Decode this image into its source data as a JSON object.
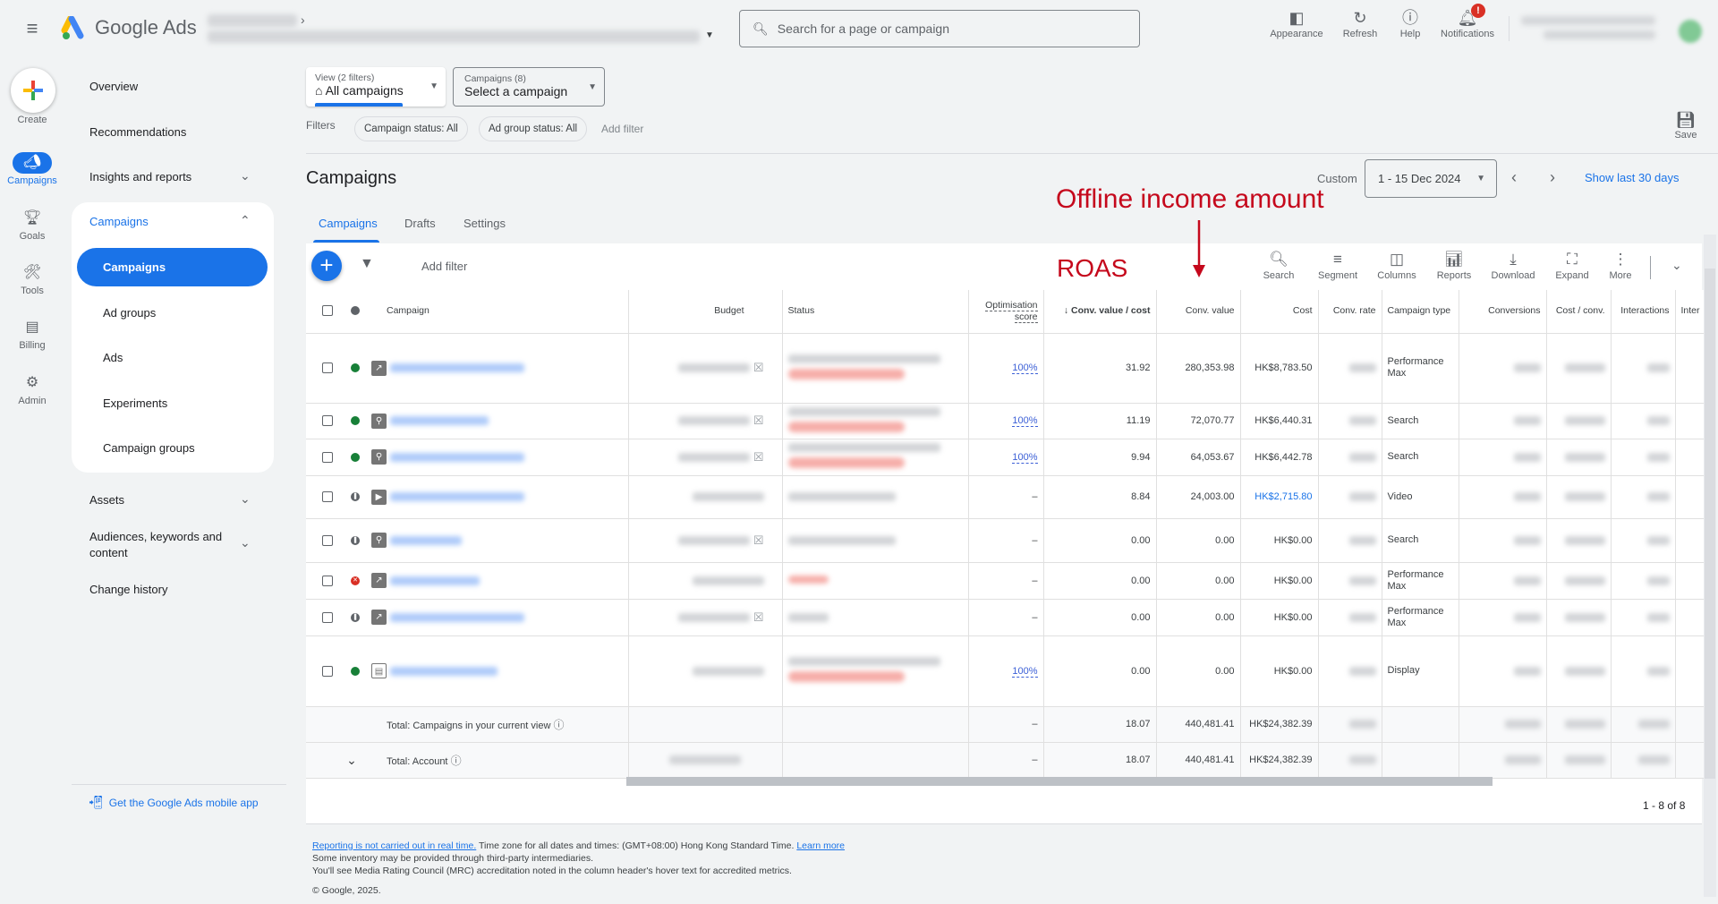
{
  "topbar": {
    "brand": "Google Ads",
    "search_placeholder": "Search for a page or campaign",
    "tools": [
      {
        "label": "Appearance",
        "icon": "appearance-icon"
      },
      {
        "label": "Refresh",
        "icon": "refresh-icon"
      },
      {
        "label": "Help",
        "icon": "help-icon"
      },
      {
        "label": "Notifications",
        "icon": "bell-icon",
        "badge": "!"
      }
    ]
  },
  "rail": {
    "items": [
      {
        "label": "Create",
        "icon": "plus-icon"
      },
      {
        "label": "Campaigns",
        "icon": "megaphone-icon",
        "active": true
      },
      {
        "label": "Goals",
        "icon": "trophy-icon"
      },
      {
        "label": "Tools",
        "icon": "tools-icon"
      },
      {
        "label": "Billing",
        "icon": "card-icon"
      },
      {
        "label": "Admin",
        "icon": "gear-icon"
      }
    ]
  },
  "nav": {
    "top_items": [
      "Overview",
      "Recommendations",
      "Insights and reports"
    ],
    "section_label": "Campaigns",
    "sub_items": [
      "Campaigns",
      "Ad groups",
      "Ads",
      "Experiments",
      "Campaign groups"
    ],
    "bottom_items": [
      "Assets",
      "Audiences, keywords and content",
      "Change history"
    ],
    "mobile_app": "Get the Google Ads mobile app"
  },
  "filters": {
    "view_label": "View (2 filters)",
    "view_value": "All campaigns",
    "campaigns_label": "Campaigns (8)",
    "campaigns_value": "Select a campaign",
    "filters_label": "Filters",
    "chips": [
      "Campaign status: All",
      "Ad group status: All"
    ],
    "add_filter": "Add filter",
    "save": "Save"
  },
  "page": {
    "title": "Campaigns",
    "date_mode": "Custom",
    "date_range": "1 - 15 Dec 2024",
    "show_last": "Show last 30 days",
    "tabs": [
      "Campaigns",
      "Drafts",
      "Settings"
    ],
    "active_tab": 0
  },
  "annotations": {
    "top": "Offline income amount",
    "roas": "ROAS",
    "color": "#c5081c"
  },
  "table_toolbar": {
    "add_filter": "Add filter",
    "tools": [
      "Search",
      "Segment",
      "Columns",
      "Reports",
      "Download",
      "Expand",
      "More"
    ]
  },
  "table": {
    "headers": {
      "campaign": "Campaign",
      "budget": "Budget",
      "status": "Status",
      "opt_score": "Optimisation score",
      "conv_value_cost": "Conv. value / cost",
      "conv_value": "Conv. value",
      "cost": "Cost",
      "conv_rate": "Conv. rate",
      "campaign_type": "Campaign type",
      "conversions": "Conversions",
      "cost_conv": "Cost / conv.",
      "interactions": "Interactions",
      "inter": "Inter"
    },
    "rows": [
      {
        "status": "enabled",
        "type_icon": "performance-max-icon",
        "opt": "100%",
        "roas": "31.92",
        "conv_value": "280,353.98",
        "cost": "HK$8,783.50",
        "cost_link": false,
        "type": "Performance Max"
      },
      {
        "status": "enabled",
        "type_icon": "search-campaign-icon",
        "opt": "100%",
        "roas": "11.19",
        "conv_value": "72,070.77",
        "cost": "HK$6,440.31",
        "cost_link": false,
        "type": "Search"
      },
      {
        "status": "enabled",
        "type_icon": "dsa-campaign-icon",
        "opt": "100%",
        "roas": "9.94",
        "conv_value": "64,053.67",
        "cost": "HK$6,442.78",
        "cost_link": false,
        "type": "Search"
      },
      {
        "status": "paused",
        "type_icon": "video-campaign-icon",
        "opt": "–",
        "roas": "8.84",
        "conv_value": "24,003.00",
        "cost": "HK$2,715.80",
        "cost_link": true,
        "type": "Video"
      },
      {
        "status": "paused",
        "type_icon": "search-campaign-icon",
        "opt": "–",
        "roas": "0.00",
        "conv_value": "0.00",
        "cost": "HK$0.00",
        "cost_link": false,
        "type": "Search"
      },
      {
        "status": "removed",
        "type_icon": "performance-max-icon",
        "opt": "–",
        "roas": "0.00",
        "conv_value": "0.00",
        "cost": "HK$0.00",
        "cost_link": false,
        "type": "Performance Max"
      },
      {
        "status": "paused",
        "type_icon": "performance-max-icon",
        "opt": "–",
        "roas": "0.00",
        "conv_value": "0.00",
        "cost": "HK$0.00",
        "cost_link": false,
        "type": "Performance Max"
      },
      {
        "status": "enabled",
        "type_icon": "display-campaign-icon",
        "opt": "100%",
        "roas": "0.00",
        "conv_value": "0.00",
        "cost": "HK$0.00",
        "cost_link": false,
        "type": "Display"
      }
    ],
    "totals": [
      {
        "label": "Total: Campaigns in your current view",
        "opt": "–",
        "roas": "18.07",
        "conv_value": "440,481.41",
        "cost": "HK$24,382.39"
      },
      {
        "label": "Total: Account",
        "opt": "–",
        "roas": "18.07",
        "conv_value": "440,481.41",
        "cost": "HK$24,382.39"
      }
    ],
    "pager": "1 - 8 of 8"
  },
  "footer": {
    "realtime_link": "Reporting is not carried out in real time.",
    "timezone": " Time zone for all dates and times: (GMT+08:00) Hong Kong Standard Time. ",
    "learn_more": "Learn more",
    "line2": "Some inventory may be provided through third-party intermediaries.",
    "line3": "You'll see Media Rating Council (MRC) accreditation noted in the column header's hover text for accredited metrics.",
    "copyright": "© Google, 2025."
  }
}
